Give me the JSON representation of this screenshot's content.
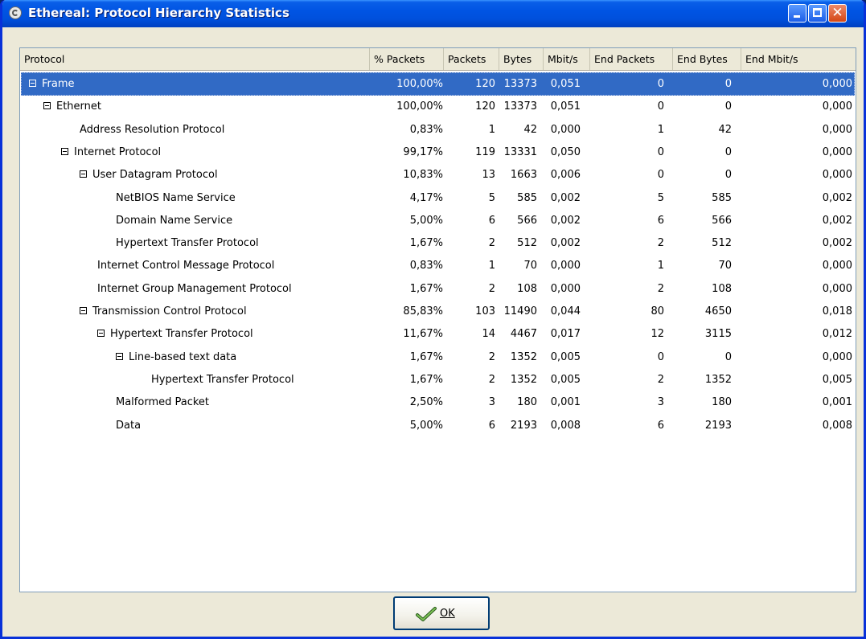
{
  "window": {
    "title": "Ethereal: Protocol Hierarchy Statistics"
  },
  "table": {
    "columns": [
      "Protocol",
      "% Packets",
      "Packets",
      "Bytes",
      "Mbit/s",
      "End Packets",
      "End Bytes",
      "End Mbit/s"
    ],
    "rows": [
      {
        "protocol": "Frame",
        "expandable": true,
        "selected": true,
        "pct": "100,00%",
        "packets": "120",
        "bytes": "13373",
        "mbit": "0,051",
        "end_packets": "0",
        "end_bytes": "0",
        "end_mbit": "0,000"
      },
      {
        "protocol": "Ethernet",
        "expandable": true,
        "pct": "100,00%",
        "packets": "120",
        "bytes": "13373",
        "mbit": "0,051",
        "end_packets": "0",
        "end_bytes": "0",
        "end_mbit": "0,000"
      },
      {
        "protocol": "Address Resolution Protocol",
        "expandable": false,
        "pct": "0,83%",
        "packets": "1",
        "bytes": "42",
        "mbit": "0,000",
        "end_packets": "1",
        "end_bytes": "42",
        "end_mbit": "0,000"
      },
      {
        "protocol": "Internet Protocol",
        "expandable": true,
        "pct": "99,17%",
        "packets": "119",
        "bytes": "13331",
        "mbit": "0,050",
        "end_packets": "0",
        "end_bytes": "0",
        "end_mbit": "0,000"
      },
      {
        "protocol": "User Datagram Protocol",
        "expandable": true,
        "pct": "10,83%",
        "packets": "13",
        "bytes": "1663",
        "mbit": "0,006",
        "end_packets": "0",
        "end_bytes": "0",
        "end_mbit": "0,000"
      },
      {
        "protocol": "NetBIOS Name Service",
        "expandable": false,
        "pct": "4,17%",
        "packets": "5",
        "bytes": "585",
        "mbit": "0,002",
        "end_packets": "5",
        "end_bytes": "585",
        "end_mbit": "0,002"
      },
      {
        "protocol": "Domain Name Service",
        "expandable": false,
        "pct": "5,00%",
        "packets": "6",
        "bytes": "566",
        "mbit": "0,002",
        "end_packets": "6",
        "end_bytes": "566",
        "end_mbit": "0,002"
      },
      {
        "protocol": "Hypertext Transfer Protocol",
        "expandable": false,
        "pct": "1,67%",
        "packets": "2",
        "bytes": "512",
        "mbit": "0,002",
        "end_packets": "2",
        "end_bytes": "512",
        "end_mbit": "0,002"
      },
      {
        "protocol": "Internet Control Message Protocol",
        "expandable": false,
        "pct": "0,83%",
        "packets": "1",
        "bytes": "70",
        "mbit": "0,000",
        "end_packets": "1",
        "end_bytes": "70",
        "end_mbit": "0,000"
      },
      {
        "protocol": "Internet Group Management Protocol",
        "expandable": false,
        "pct": "1,67%",
        "packets": "2",
        "bytes": "108",
        "mbit": "0,000",
        "end_packets": "2",
        "end_bytes": "108",
        "end_mbit": "0,000"
      },
      {
        "protocol": "Transmission Control Protocol",
        "expandable": true,
        "pct": "85,83%",
        "packets": "103",
        "bytes": "11490",
        "mbit": "0,044",
        "end_packets": "80",
        "end_bytes": "4650",
        "end_mbit": "0,018"
      },
      {
        "protocol": "Hypertext Transfer Protocol",
        "expandable": true,
        "pct": "11,67%",
        "packets": "14",
        "bytes": "4467",
        "mbit": "0,017",
        "end_packets": "12",
        "end_bytes": "3115",
        "end_mbit": "0,012"
      },
      {
        "protocol": "Line-based text data",
        "expandable": true,
        "pct": "1,67%",
        "packets": "2",
        "bytes": "1352",
        "mbit": "0,005",
        "end_packets": "0",
        "end_bytes": "0",
        "end_mbit": "0,000"
      },
      {
        "protocol": "Hypertext Transfer Protocol",
        "expandable": false,
        "pct": "1,67%",
        "packets": "2",
        "bytes": "1352",
        "mbit": "0,005",
        "end_packets": "2",
        "end_bytes": "1352",
        "end_mbit": "0,005"
      },
      {
        "protocol": "Malformed Packet",
        "expandable": false,
        "pct": "2,50%",
        "packets": "3",
        "bytes": "180",
        "mbit": "0,001",
        "end_packets": "3",
        "end_bytes": "180",
        "end_mbit": "0,001"
      },
      {
        "protocol": "Data",
        "expandable": false,
        "pct": "5,00%",
        "packets": "6",
        "bytes": "2193",
        "mbit": "0,008",
        "end_packets": "6",
        "end_bytes": "2193",
        "end_mbit": "0,008"
      }
    ]
  },
  "ok_button": {
    "label": "OK"
  }
}
